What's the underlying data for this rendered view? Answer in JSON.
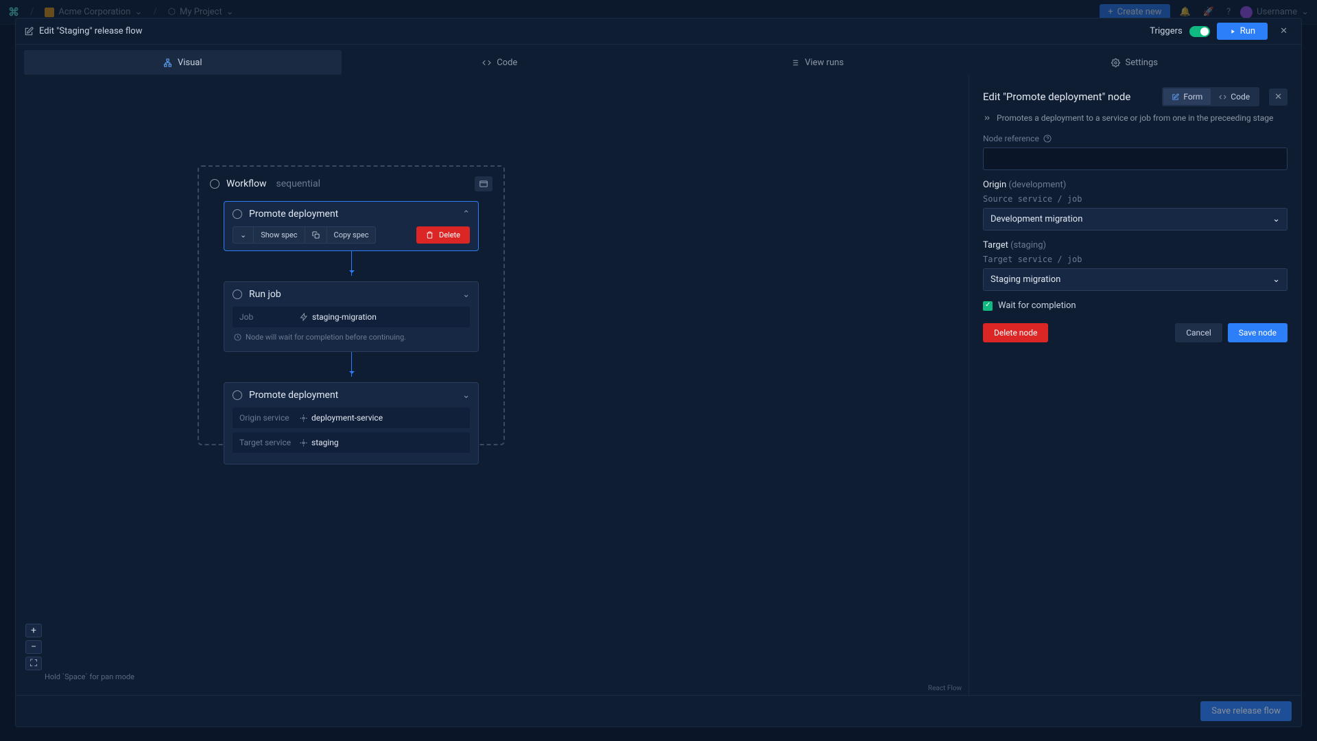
{
  "topnav": {
    "org": "Acme Corporation",
    "project": "My Project",
    "create": "Create new",
    "username": "Username"
  },
  "modal": {
    "title": "Edit \"Staging\" release flow",
    "triggers": "Triggers",
    "run": "Run",
    "tabs": {
      "visual": "Visual",
      "code": "Code",
      "view_runs": "View runs",
      "settings": "Settings"
    },
    "save_flow": "Save release flow"
  },
  "canvas": {
    "workflow_title": "Workflow",
    "workflow_mode": "sequential",
    "nodes": [
      {
        "title": "Promote deployment",
        "show_spec": "Show spec",
        "copy_spec": "Copy spec",
        "delete": "Delete"
      },
      {
        "title": "Run job",
        "job_label": "Job",
        "job_value": "staging-migration",
        "wait_note": "Node will wait for completion before continuing."
      },
      {
        "title": "Promote deployment",
        "origin_label": "Origin service",
        "origin_value": "deployment-service",
        "target_label": "Target service",
        "target_value": "staging"
      }
    ],
    "pan_hint": "Hold `Space` for pan mode",
    "attribution": "React Flow"
  },
  "sidebar": {
    "title": "Edit \"Promote deployment\" node",
    "form": "Form",
    "code": "Code",
    "description": "Promotes a deployment to a service or job from one in the preceeding stage",
    "node_ref_label": "Node reference",
    "origin_title": "Origin",
    "origin_env": "(development)",
    "source_label": "Source service / job",
    "source_value": "Development migration",
    "target_title": "Target",
    "target_env": "(staging)",
    "target_label": "Target service / job",
    "target_value": "Staging migration",
    "wait_label": "Wait for completion",
    "delete_node": "Delete node",
    "cancel": "Cancel",
    "save_node": "Save node"
  }
}
